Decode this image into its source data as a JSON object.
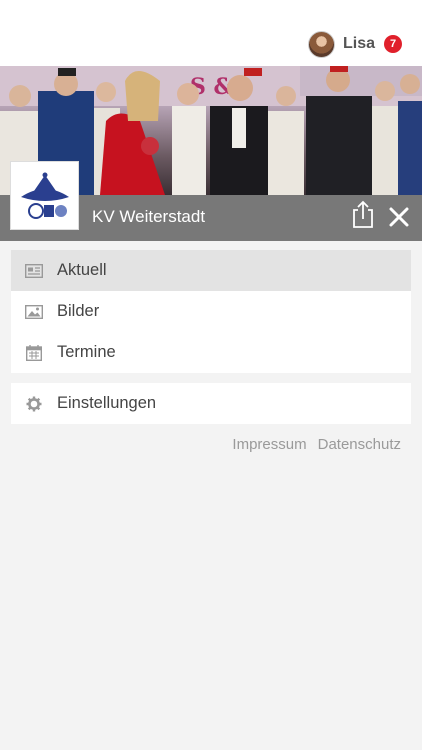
{
  "user": {
    "name": "Lisa",
    "notification_count": "7"
  },
  "club": {
    "name": "KV Weiterstadt"
  },
  "menu": {
    "items": [
      {
        "label": "Aktuell",
        "icon": "newspaper-icon",
        "active": true
      },
      {
        "label": "Bilder",
        "icon": "image-icon",
        "active": false
      },
      {
        "label": "Termine",
        "icon": "calendar-icon",
        "active": false
      }
    ]
  },
  "settings": {
    "label": "Einstellungen",
    "icon": "gear-icon"
  },
  "footer_links": {
    "impressum": "Impressum",
    "datenschutz": "Datenschutz"
  },
  "colors": {
    "badge": "#e0202b",
    "club_bar": "#6e6e6e",
    "active_item": "#e3e3e3",
    "background": "#f3f3f3"
  }
}
